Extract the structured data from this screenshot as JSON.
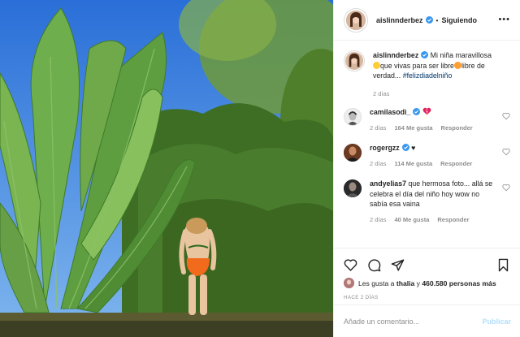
{
  "header": {
    "username": "aislinnderbez",
    "separator": "•",
    "follow_label": "Siguiendo",
    "more_icon": "more-options-icon"
  },
  "caption": {
    "username": "aislinnderbez",
    "text_1": "Mi niña maravillosa",
    "text_2": "que vivas para ser libre",
    "text_3": "libre de verdad... ",
    "hashtag": "#felizdiadelniño",
    "time": "2 días"
  },
  "comments": [
    {
      "username": "camilasodi_",
      "text": "",
      "time": "2 días",
      "likes": "164 Me gusta",
      "reply": "Responder",
      "emoji": "heart-emoji"
    },
    {
      "username": "rogergzz",
      "text": "♥",
      "time": "2 días",
      "likes": "114 Me gusta",
      "reply": "Responder"
    },
    {
      "username": "andyelias7",
      "text": "que hermosa foto... allá se celebra el día del niño hoy wow no sabía esa vaina",
      "time": "2 días",
      "likes": "40 Me gusta",
      "reply": "Responder"
    }
  ],
  "actions": {
    "icons": [
      "heart-icon",
      "comment-icon",
      "share-icon",
      "bookmark-icon"
    ]
  },
  "likes": {
    "prefix": "Les gusta a",
    "user": "thalia",
    "conjunction": "y",
    "count": "460.580 personas más"
  },
  "posted": "HACE 2 DÍAS",
  "comment_box": {
    "placeholder": "Añade un comentario...",
    "publish_label": "Publicar"
  },
  "colors": {
    "sky": "#3d83e6",
    "link": "#00376b",
    "publish_disabled": "#b2dffc",
    "verified": "#3897f0"
  }
}
